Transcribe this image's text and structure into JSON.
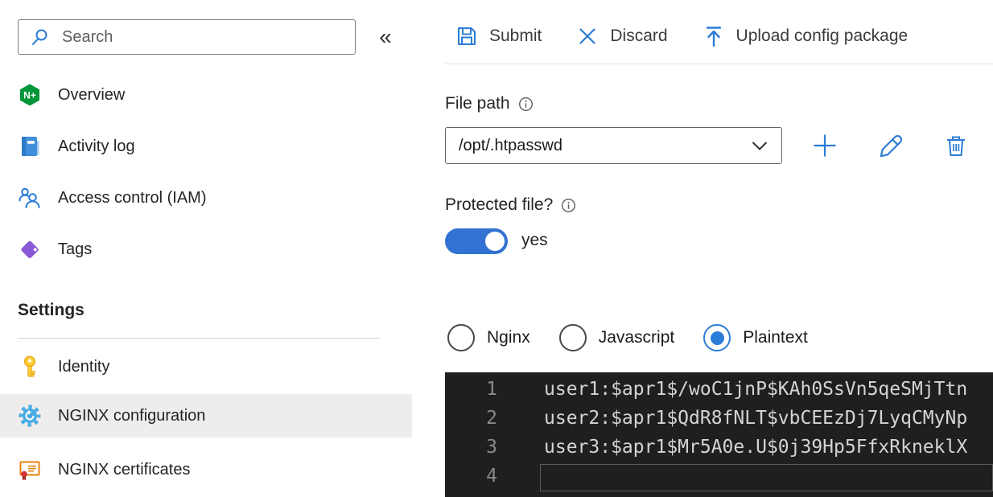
{
  "colors": {
    "accent": "#2b7cd6",
    "toggle_on": "#3272d2",
    "nginx_green": "#009639",
    "selected_row_bg": "#efedeb",
    "editor_bg": "#1f1f1f",
    "editor_text": "#d4d4d4",
    "editor_line_number": "#8a8a8a"
  },
  "sidebar": {
    "search_placeholder": "Search",
    "collapse_glyph": "«",
    "nav": [
      {
        "label": "Overview",
        "icon": "nginx-logo-icon"
      },
      {
        "label": "Activity log",
        "icon": "activity-log-icon"
      },
      {
        "label": "Access control (IAM)",
        "icon": "access-control-icon"
      },
      {
        "label": "Tags",
        "icon": "tag-icon"
      }
    ],
    "settings_header": "Settings",
    "settings_nav": [
      {
        "label": "Identity",
        "icon": "key-icon",
        "selected": false
      },
      {
        "label": "NGINX configuration",
        "icon": "gear-icon",
        "selected": true
      },
      {
        "label": "NGINX certificates",
        "icon": "certificate-icon",
        "selected": false
      }
    ]
  },
  "toolbar": {
    "submit_label": "Submit",
    "discard_label": "Discard",
    "upload_label": "Upload config package"
  },
  "form": {
    "file_path_label": "File path",
    "file_path_value": "/opt/.htpasswd",
    "protected_label": "Protected file?",
    "protected_value": "yes",
    "syntax_options": [
      {
        "label": "Nginx",
        "selected": false
      },
      {
        "label": "Javascript",
        "selected": false
      },
      {
        "label": "Plaintext",
        "selected": true
      }
    ]
  },
  "editor": {
    "lines": [
      {
        "number": "1",
        "text": "user1:$apr1$/woC1jnP$KAh0SsVn5qeSMjTtn"
      },
      {
        "number": "2",
        "text": "user2:$apr1$QdR8fNLT$vbCEEzDj7LyqCMyNp"
      },
      {
        "number": "3",
        "text": "user3:$apr1$Mr5A0e.U$0j39Hp5FfxRkneklX"
      },
      {
        "number": "4",
        "text": ""
      }
    ]
  }
}
